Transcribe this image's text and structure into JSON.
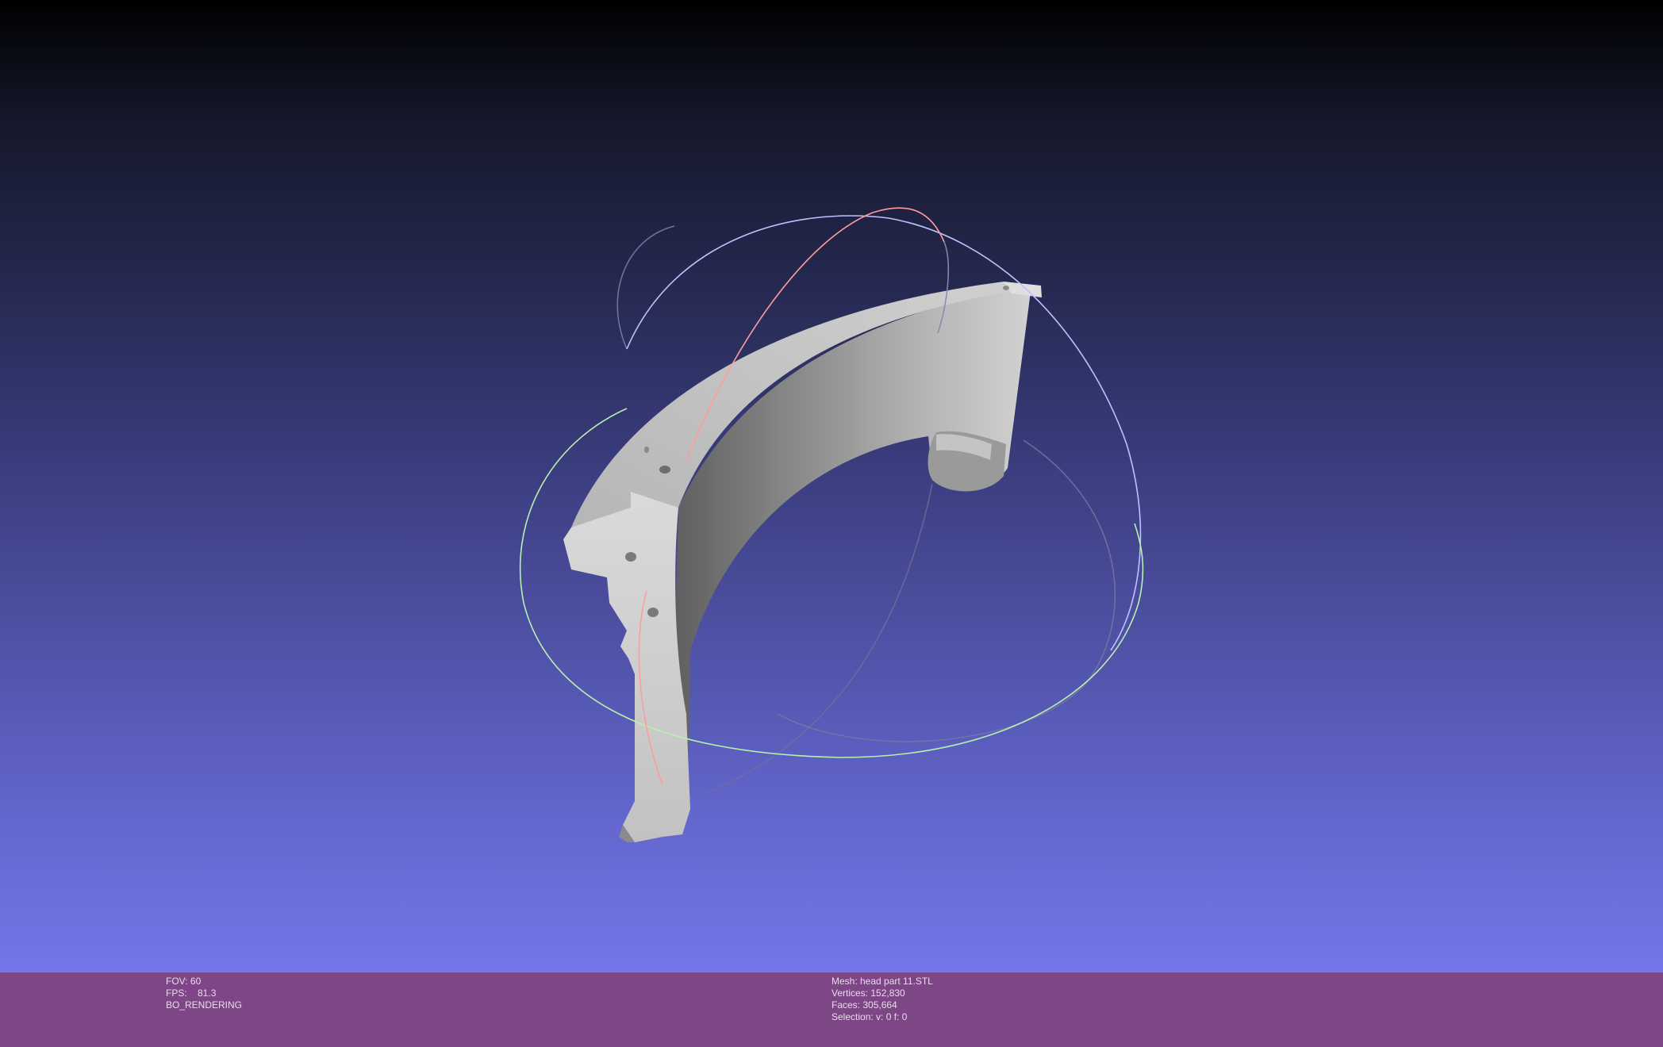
{
  "render_info": {
    "fov": "FOV: 60",
    "fps": "FPS:    81.3",
    "mode": "BO_RENDERING"
  },
  "mesh_info": {
    "mesh": "Mesh: head part 11.STL",
    "vertices": "Vertices: 152,830",
    "faces": "Faces: 305,664",
    "selection": "Selection: v: 0 f: 0"
  },
  "colors": {
    "bg_top": "#000000",
    "bg_bottom": "#7476ea",
    "statusbar": "#7e4687",
    "model": "#c8c8c8",
    "trackball_x": "#ff9a9a",
    "trackball_y": "#9aff9a",
    "trackball_z": "#b0b0ff"
  }
}
